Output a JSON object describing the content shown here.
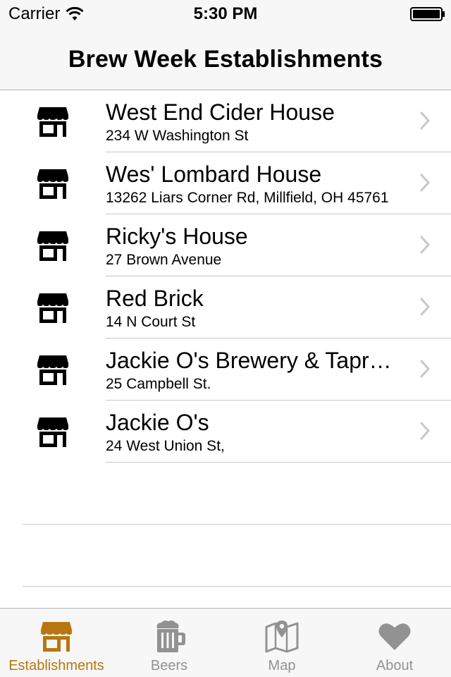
{
  "status_bar": {
    "carrier": "Carrier",
    "time": "5:30 PM"
  },
  "nav": {
    "title": "Brew Week Establishments"
  },
  "establishments": [
    {
      "name": "West End Cider House",
      "address": "234 W Washington St"
    },
    {
      "name": "Wes' Lombard House",
      "address": "13262 Liars Corner Rd, Millfield, OH 45761"
    },
    {
      "name": "Ricky's House",
      "address": "27 Brown Avenue"
    },
    {
      "name": "Red Brick",
      "address": "14 N Court St"
    },
    {
      "name": "Jackie O's Brewery & Taproom",
      "address": "25 Campbell St."
    },
    {
      "name": "Jackie O's",
      "address": "24 West Union St,"
    }
  ],
  "tabs": [
    {
      "label": "Establishments",
      "icon": "storefront-icon",
      "active": true
    },
    {
      "label": "Beers",
      "icon": "beer-mug-icon",
      "active": false
    },
    {
      "label": "Map",
      "icon": "map-pin-icon",
      "active": false
    },
    {
      "label": "About",
      "icon": "heart-icon",
      "active": false
    }
  ],
  "colors": {
    "tint": "#b7760f",
    "inactive": "#929292",
    "separator": "#c8c7cc",
    "bar_background": "#f7f7f7"
  }
}
